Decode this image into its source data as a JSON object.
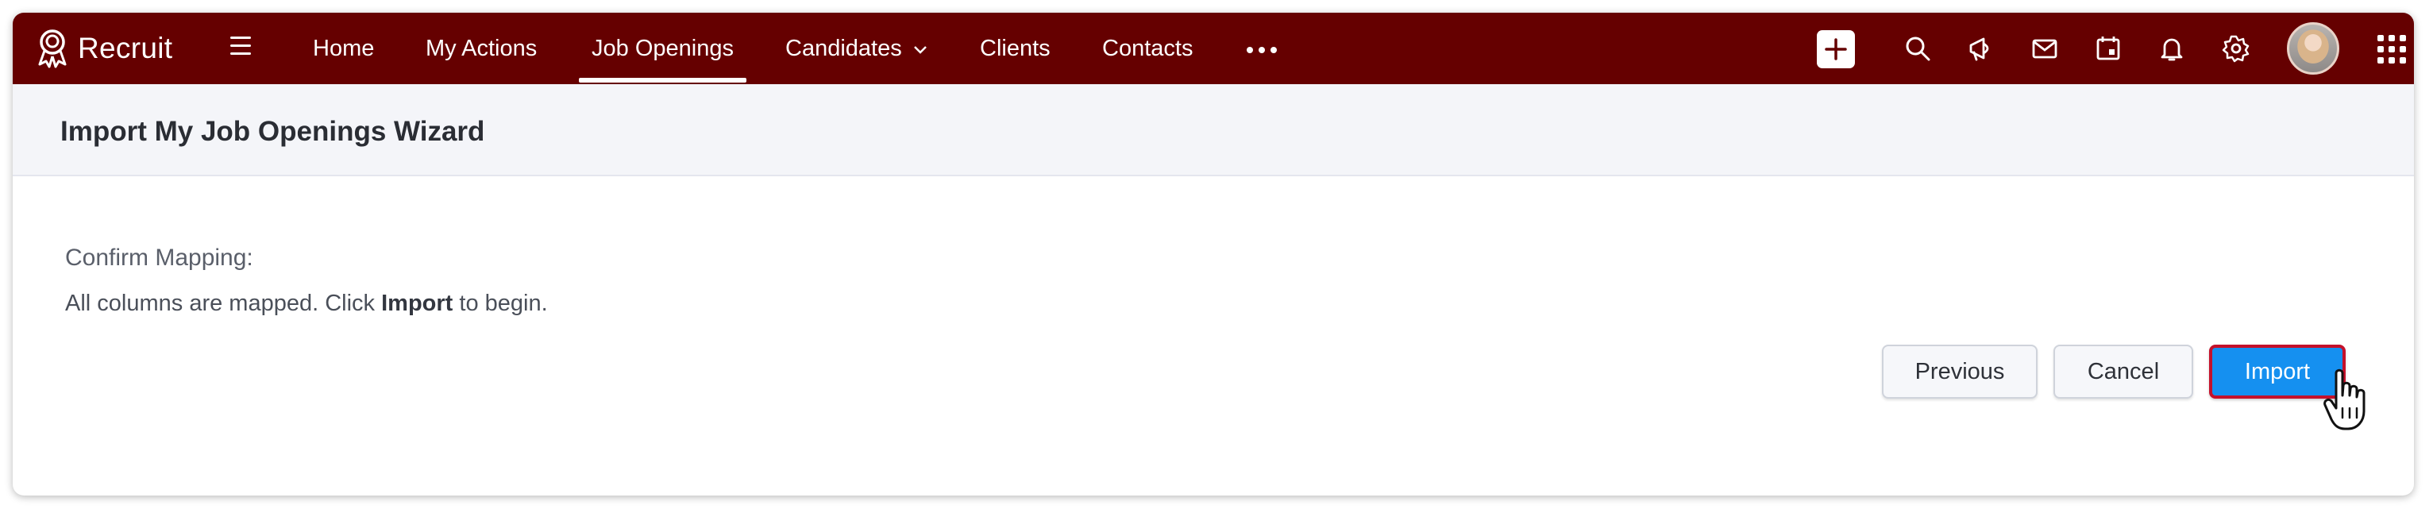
{
  "app": {
    "name": "Recruit"
  },
  "nav": {
    "items": [
      {
        "label": "Home"
      },
      {
        "label": "My Actions"
      },
      {
        "label": "Job Openings",
        "active": true
      },
      {
        "label": "Candidates",
        "has_dropdown": true
      },
      {
        "label": "Clients"
      },
      {
        "label": "Contacts"
      }
    ],
    "icons": [
      "menu-icon",
      "more-icon",
      "plus-icon",
      "search-icon",
      "megaphone-icon",
      "mail-icon",
      "calendar-icon",
      "bell-icon",
      "gear-icon",
      "apps-grid-icon"
    ]
  },
  "page": {
    "title": "Import My Job Openings Wizard",
    "section_label": "Confirm Mapping:",
    "message_prefix": "All columns are mapped. Click ",
    "message_bold": "Import",
    "message_suffix": " to begin."
  },
  "actions": {
    "previous_label": "Previous",
    "cancel_label": "Cancel",
    "import_label": "Import"
  },
  "colors": {
    "topbar": "#650000",
    "primary_button": "#1590f0",
    "primary_button_border": "#c4112b",
    "title_band": "#f4f5f9"
  }
}
